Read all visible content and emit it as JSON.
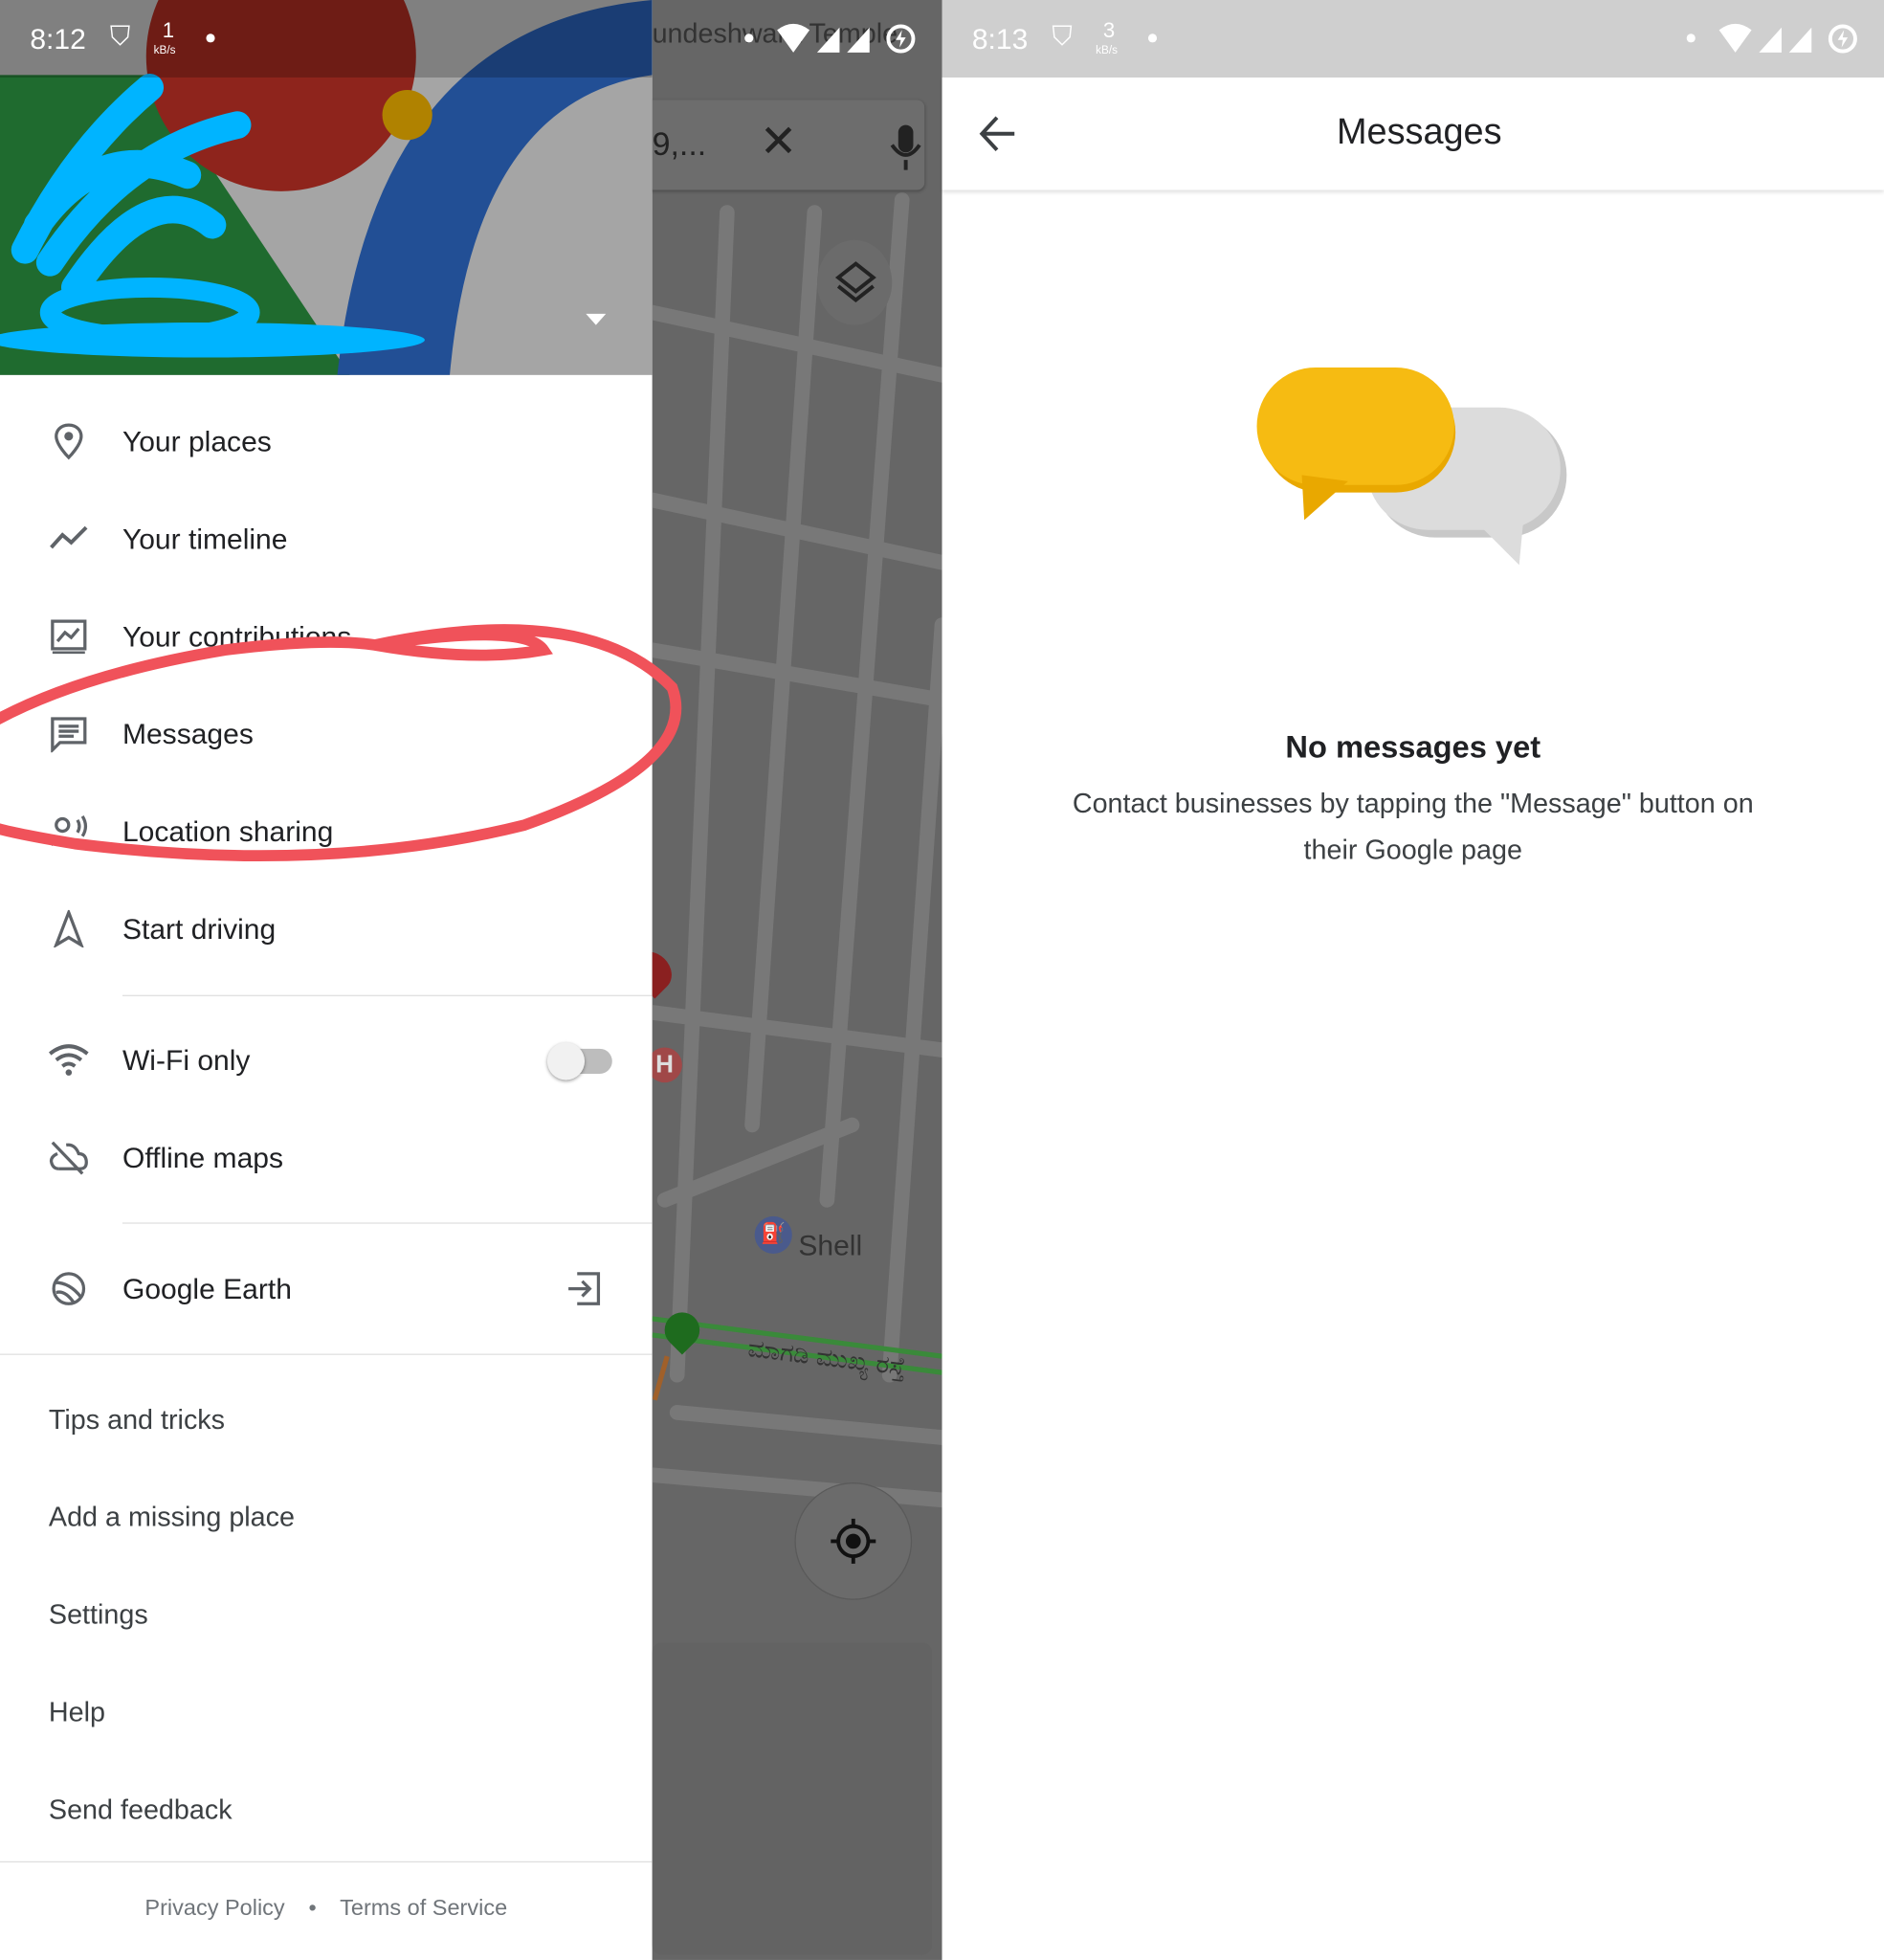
{
  "left_screen": {
    "status_bar": {
      "time": "8:12",
      "speed_value": "1",
      "speed_unit": "kB/s"
    },
    "map_search_snippet": "9,...",
    "map_top_label": "undeshwara Temple",
    "map_poi_shell": "Shell",
    "map_road_label": "ಮಾಗಡಿ ಮುಖ್ಯ ರಸ್ತೆ",
    "menu": {
      "primary": [
        {
          "label": "Your places",
          "icon": "location-pin-icon"
        },
        {
          "label": "Your timeline",
          "icon": "timeline-icon"
        },
        {
          "label": "Your contributions",
          "icon": "contributions-icon"
        },
        {
          "label": "Messages",
          "icon": "message-icon"
        },
        {
          "label": "Location sharing",
          "icon": "location-sharing-icon"
        },
        {
          "label": "Start driving",
          "icon": "navigation-icon"
        }
      ],
      "wifi_only": {
        "label": "Wi-Fi only",
        "icon": "wifi-icon",
        "enabled": false
      },
      "offline_maps": {
        "label": "Offline maps",
        "icon": "offline-icon"
      },
      "google_earth": {
        "label": "Google Earth",
        "icon": "earth-icon"
      },
      "secondary": [
        "Tips and tricks",
        "Add a missing place",
        "Settings",
        "Help",
        "Send feedback"
      ],
      "footer": {
        "privacy": "Privacy Policy",
        "separator": "•",
        "terms": "Terms of Service"
      }
    },
    "annotation_color": "#f0525a",
    "scribble_color": "#00b4ff"
  },
  "right_screen": {
    "status_bar": {
      "time": "8:13",
      "speed_value": "3",
      "speed_unit": "kB/s"
    },
    "title": "Messages",
    "empty_title": "No messages yet",
    "empty_body_line1": "Contact businesses by tapping the \"Message\" button on",
    "empty_body_line2": "their Google page",
    "bubble_colors": {
      "primary": "#f6bb12",
      "secondary": "#dcdcdc"
    }
  }
}
